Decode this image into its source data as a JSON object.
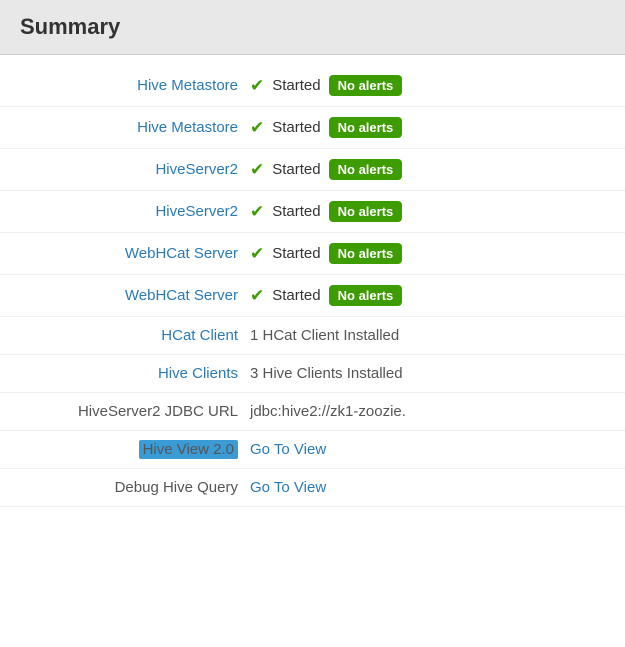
{
  "header": {
    "title": "Summary"
  },
  "rows": [
    {
      "id": "hive-metastore-1",
      "label": "Hive Metastore",
      "label_type": "link",
      "status": "started",
      "status_text": "Started",
      "badge": "No alerts",
      "show_badge": true,
      "info_text": ""
    },
    {
      "id": "hive-metastore-2",
      "label": "Hive Metastore",
      "label_type": "link",
      "status": "started",
      "status_text": "Started",
      "badge": "No alerts",
      "show_badge": true,
      "info_text": ""
    },
    {
      "id": "hiveserver2-1",
      "label": "HiveServer2",
      "label_type": "link",
      "status": "started",
      "status_text": "Started",
      "badge": "No alerts",
      "show_badge": true,
      "info_text": ""
    },
    {
      "id": "hiveserver2-2",
      "label": "HiveServer2",
      "label_type": "link",
      "status": "started",
      "status_text": "Started",
      "badge": "No alerts",
      "show_badge": true,
      "info_text": ""
    },
    {
      "id": "webhcat-server-1",
      "label": "WebHCat Server",
      "label_type": "link",
      "status": "started",
      "status_text": "Started",
      "badge": "No alerts",
      "show_badge": true,
      "info_text": ""
    },
    {
      "id": "webhcat-server-2",
      "label": "WebHCat Server",
      "label_type": "link",
      "status": "started",
      "status_text": "Started",
      "badge": "No alerts",
      "show_badge": true,
      "info_text": ""
    },
    {
      "id": "hcat-client",
      "label": "HCat Client",
      "label_type": "link",
      "status": "info",
      "status_text": "",
      "badge": "",
      "show_badge": false,
      "info_text": "1 HCat Client Installed"
    },
    {
      "id": "hive-clients",
      "label": "Hive Clients",
      "label_type": "link",
      "status": "info",
      "status_text": "",
      "badge": "",
      "show_badge": false,
      "info_text": "3 Hive Clients Installed"
    },
    {
      "id": "jdbc-url",
      "label": "HiveServer2 JDBC URL",
      "label_type": "text",
      "status": "info",
      "status_text": "",
      "badge": "",
      "show_badge": false,
      "info_text": "jdbc:hive2://zk1-zoozie."
    },
    {
      "id": "hive-view",
      "label": "Hive View 2.0",
      "label_type": "highlighted",
      "status": "link",
      "status_text": "",
      "badge": "",
      "show_badge": false,
      "info_text": "",
      "link_text": "Go To View"
    },
    {
      "id": "debug-hive-query",
      "label": "Debug Hive Query",
      "label_type": "text",
      "status": "link",
      "status_text": "",
      "badge": "",
      "show_badge": false,
      "info_text": "",
      "link_text": "Go To View"
    }
  ],
  "check_icon": "✔",
  "no_alerts_label": "No alerts",
  "go_to_view_label": "Go To View"
}
